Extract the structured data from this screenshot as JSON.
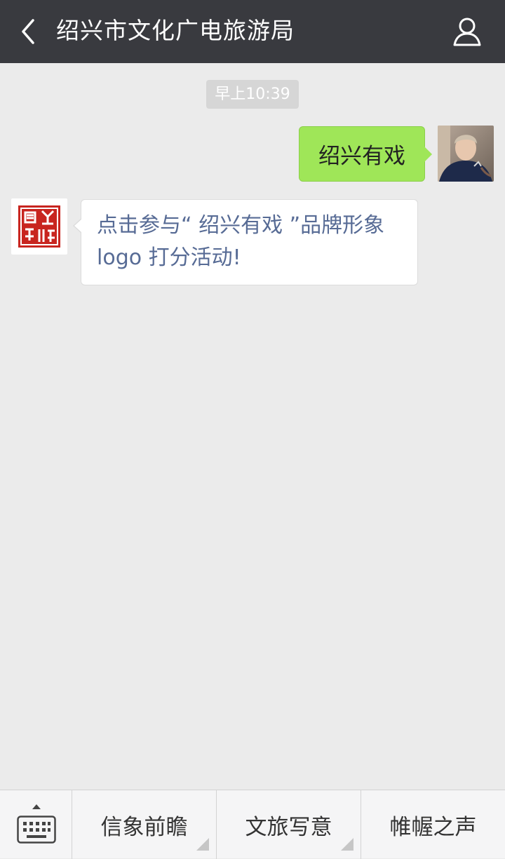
{
  "header": {
    "title": "绍兴市文化广电旅游局",
    "back_icon": "chevron-left-icon",
    "profile_icon": "person-icon"
  },
  "chat": {
    "timestamp": "早上10:39",
    "messages": [
      {
        "direction": "outgoing",
        "text": "绍兴有戏"
      },
      {
        "direction": "incoming",
        "lines": [
          "点击参与“ 绍兴有戏 ”品牌形象",
          "logo 打分活动!"
        ]
      }
    ]
  },
  "bottom_menu": {
    "keyboard_icon": "keyboard-icon",
    "items": [
      {
        "label": "信象前瞻",
        "has_submenu": true
      },
      {
        "label": "文旅写意",
        "has_submenu": true
      },
      {
        "label": "帷幄之声",
        "has_submenu": false
      }
    ]
  },
  "colors": {
    "topbar": "#393a3f",
    "background": "#ebebeb",
    "outgoing_bubble": "#9fe658",
    "link_text": "#576b95",
    "seal_red": "#c8251f"
  }
}
